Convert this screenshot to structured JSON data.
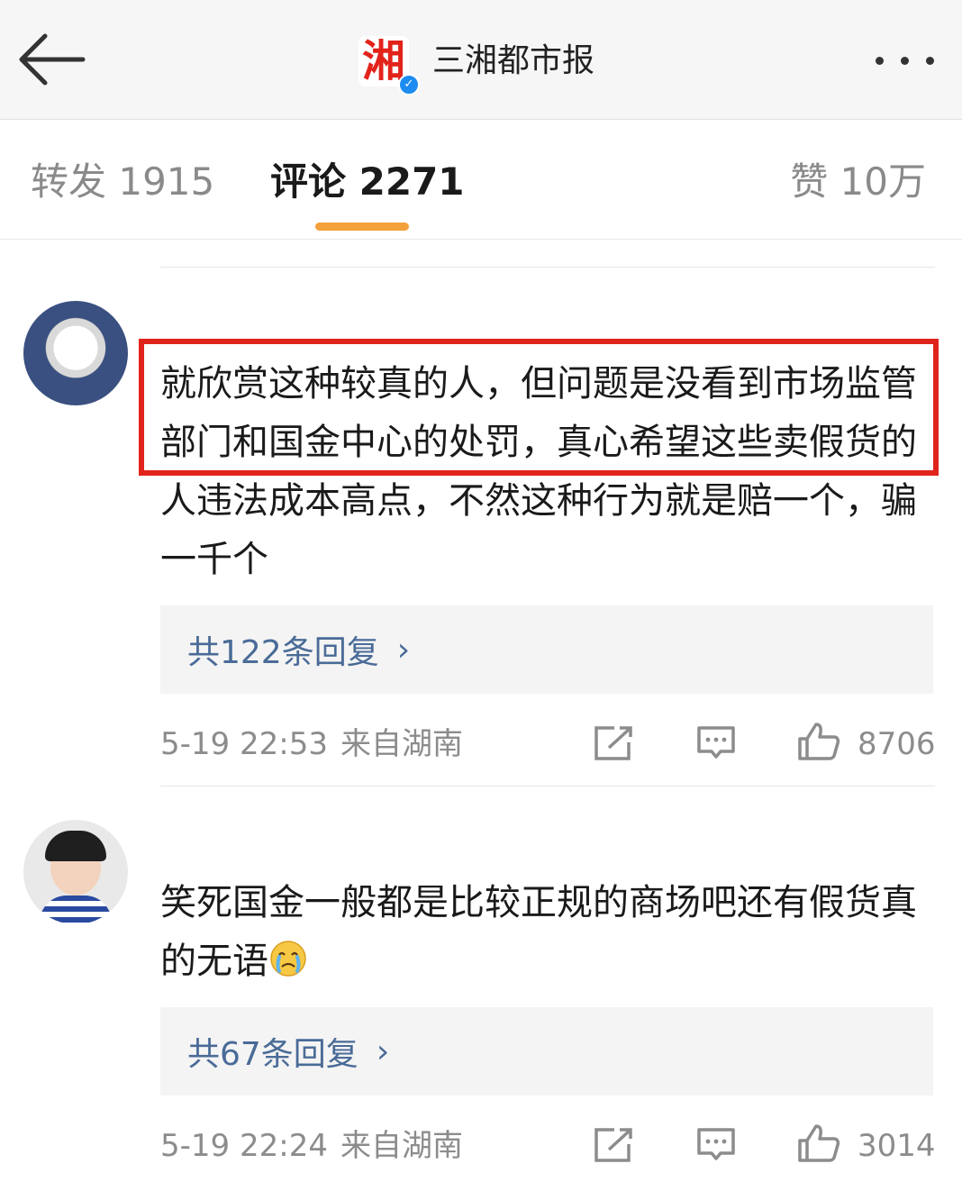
{
  "header": {
    "logo_text": "湘",
    "account_name": "三湘都市报",
    "verified_mark": "✓"
  },
  "tabs": {
    "forward": "转发 1915",
    "comments": "评论 2271",
    "likes": "赞 10万"
  },
  "colors": {
    "accent": "#f3a13a",
    "highlight_border": "#e0241c",
    "reply_link": "#4a6b97",
    "logo_red": "#e2231a"
  },
  "comments": [
    {
      "text": "就欣赏这种较真的人，但问题是没看到市场监管部门和国金中心的处罚，真心希望这些卖假货的人违法成本高点，不然这种行为就是赔一个，骗一千个",
      "replies": "共122条回复",
      "time": "5-19 22:53",
      "location": "来自湖南",
      "likes": "8706"
    },
    {
      "text": "笑死国金一般都是比较正规的商场吧还有假货真的无语",
      "emoji": "crying-face-icon",
      "replies": "共67条回复",
      "time": "5-19 22:24",
      "location": "来自湖南",
      "likes": "3014"
    }
  ]
}
